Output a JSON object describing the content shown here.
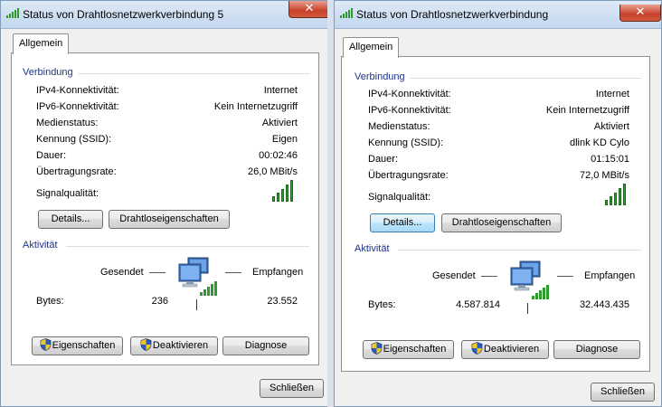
{
  "left": {
    "title": "Status von Drahtlosnetzwerkverbindung 5",
    "tab": "Allgemein",
    "connection_group": "Verbindung",
    "ipv4_label": "IPv4-Konnektivität:",
    "ipv4_value": "Internet",
    "ipv6_label": "IPv6-Konnektivität:",
    "ipv6_value": "Kein Internetzugriff",
    "media_label": "Medienstatus:",
    "media_value": "Aktiviert",
    "ssid_label": "Kennung (SSID):",
    "ssid_value": "Eigen",
    "duration_label": "Dauer:",
    "duration_value": "00:02:46",
    "speed_label": "Übertragungsrate:",
    "speed_value": "26,0 MBit/s",
    "signal_label": "Signalqualität:",
    "details_button": "Details...",
    "wireless_props_button": "Drahtloseigenschaften",
    "activity_group": "Aktivität",
    "sent_label": "Gesendet",
    "received_label": "Empfangen",
    "bytes_label": "Bytes:",
    "bytes_sent": "236",
    "bytes_received": "23.552",
    "properties_button": "Eigenschaften",
    "disable_button": "Deaktivieren",
    "diagnose_button": "Diagnose",
    "close_button": "Schließen",
    "close_x": "✕"
  },
  "right": {
    "title": "Status von Drahtlosnetzwerkverbindung",
    "tab": "Allgemein",
    "connection_group": "Verbindung",
    "ipv4_label": "IPv4-Konnektivität:",
    "ipv4_value": "Internet",
    "ipv6_label": "IPv6-Konnektivität:",
    "ipv6_value": "Kein Internetzugriff",
    "media_label": "Medienstatus:",
    "media_value": "Aktiviert",
    "ssid_label": "Kennung (SSID):",
    "ssid_value": "dlink KD Cylo",
    "duration_label": "Dauer:",
    "duration_value": "01:15:01",
    "speed_label": "Übertragungsrate:",
    "speed_value": "72,0 MBit/s",
    "signal_label": "Signalqualität:",
    "details_button": "Details...",
    "wireless_props_button": "Drahtloseigenschaften",
    "activity_group": "Aktivität",
    "sent_label": "Gesendet",
    "received_label": "Empfangen",
    "bytes_label": "Bytes:",
    "bytes_sent": "4.587.814",
    "bytes_received": "32.443.435",
    "properties_button": "Eigenschaften",
    "disable_button": "Deaktivieren",
    "diagnose_button": "Diagnose",
    "close_button": "Schließen",
    "close_x": "✕"
  },
  "icons": {
    "title_icon": "wifi-signal-icon",
    "signal_icon": "signal-bars-icon",
    "network_icon": "computer-network-icon",
    "uac_icon": "uac-shield-icon"
  },
  "colors": {
    "group_text": "#1e3287",
    "signal_green": "#2e9a2e"
  }
}
